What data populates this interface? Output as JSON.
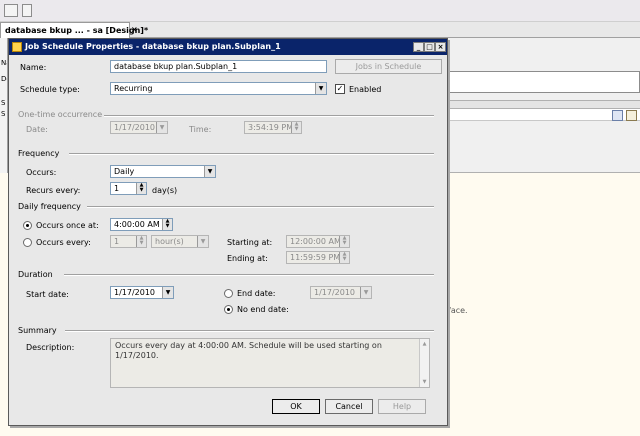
{
  "background": {
    "tab_label": "database bkup ... - sa [Design]*",
    "left_labels": [
      "Na",
      "De",
      "S",
      "S"
    ],
    "right_snippet": "face."
  },
  "dialog": {
    "title": "Job Schedule Properties - database bkup plan.Subplan_1",
    "name_label": "Name:",
    "name_value": "database bkup plan.Subplan_1",
    "jobs_button": "Jobs in Schedule",
    "schedule_type_label": "Schedule type:",
    "schedule_type_value": "Recurring",
    "enabled_label": "Enabled",
    "enabled_checked": true,
    "one_time": {
      "header": "One-time occurrence",
      "date_label": "Date:",
      "date_value": "1/17/2010",
      "time_label": "Time:",
      "time_value": "3:54:19 PM"
    },
    "frequency": {
      "header": "Frequency",
      "occurs_label": "Occurs:",
      "occurs_value": "Daily",
      "recurs_label": "Recurs every:",
      "recurs_value": "1",
      "recurs_unit": "day(s)"
    },
    "daily_frequency": {
      "header": "Daily frequency",
      "once_label": "Occurs once at:",
      "once_value": "4:00:00 AM",
      "every_label": "Occurs every:",
      "every_value": "1",
      "every_unit": "hour(s)",
      "starting_label": "Starting at:",
      "starting_value": "12:00:00 AM",
      "ending_label": "Ending at:",
      "ending_value": "11:59:59 PM",
      "selected": "once"
    },
    "duration": {
      "header": "Duration",
      "start_label": "Start date:",
      "start_value": "1/17/2010",
      "end_label": "End date:",
      "end_value": "1/17/2010",
      "no_end_label": "No end date:",
      "selected": "no_end"
    },
    "summary": {
      "header": "Summary",
      "description_label": "Description:",
      "description_value": "Occurs every day at 4:00:00 AM. Schedule will be used starting on 1/17/2010."
    },
    "buttons": {
      "ok": "OK",
      "cancel": "Cancel",
      "help": "Help"
    }
  }
}
